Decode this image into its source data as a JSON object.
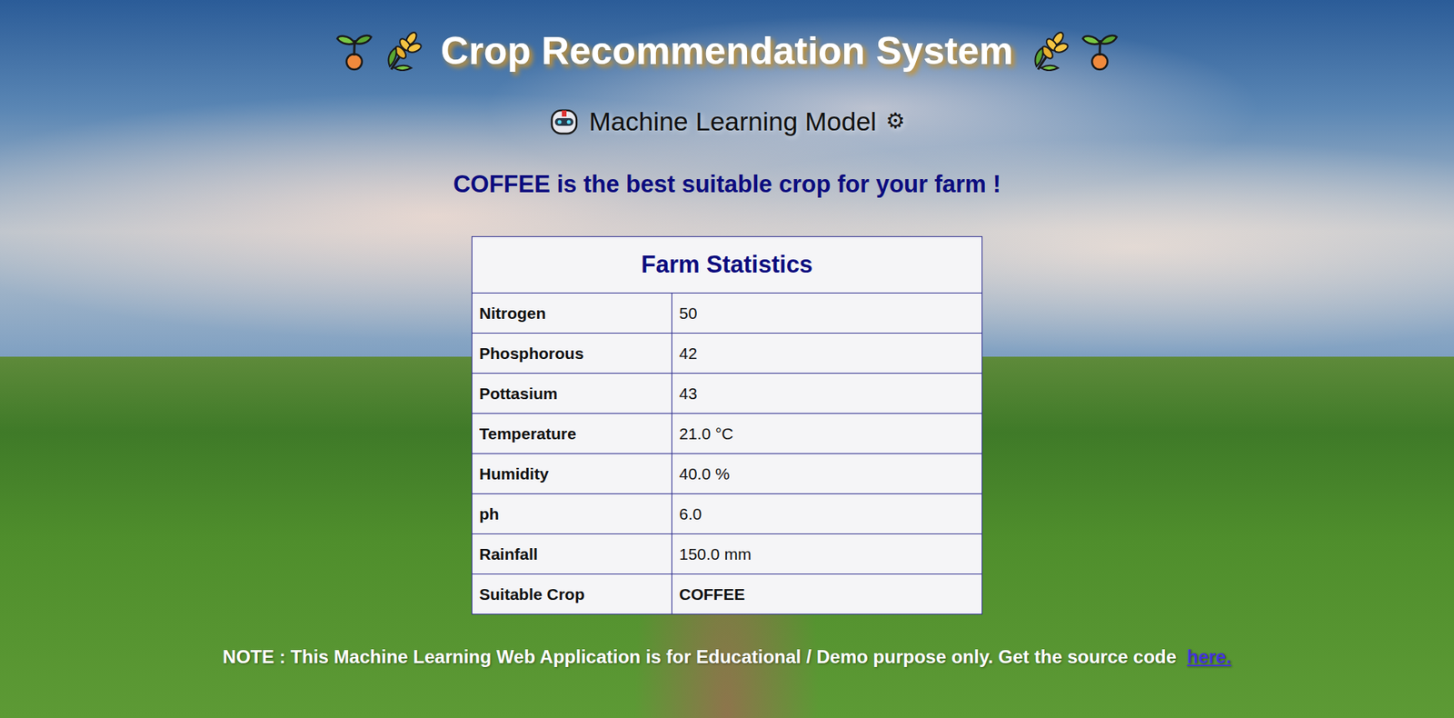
{
  "title": "Crop Recommendation System",
  "subtitle": "Machine Learning Model",
  "subtitle_icon": "⚙",
  "result": "COFFEE is the best suitable crop for your farm !",
  "table": {
    "title": "Farm Statistics",
    "rows": [
      {
        "label": "Nitrogen",
        "value": "50",
        "bold": false
      },
      {
        "label": "Phosphorous",
        "value": "42",
        "bold": false
      },
      {
        "label": "Pottasium",
        "value": "43",
        "bold": false
      },
      {
        "label": "Temperature",
        "value": "21.0 °C",
        "bold": false
      },
      {
        "label": "Humidity",
        "value": "40.0 %",
        "bold": false
      },
      {
        "label": "ph",
        "value": "6.0",
        "bold": false
      },
      {
        "label": "Rainfall",
        "value": "150.0 mm",
        "bold": false
      },
      {
        "label": "Suitable Crop",
        "value": "COFFEE",
        "bold": true
      }
    ]
  },
  "note": {
    "text": "NOTE : This Machine Learning Web Application is for Educational / Demo purpose only. Get the source code",
    "link": "here."
  }
}
